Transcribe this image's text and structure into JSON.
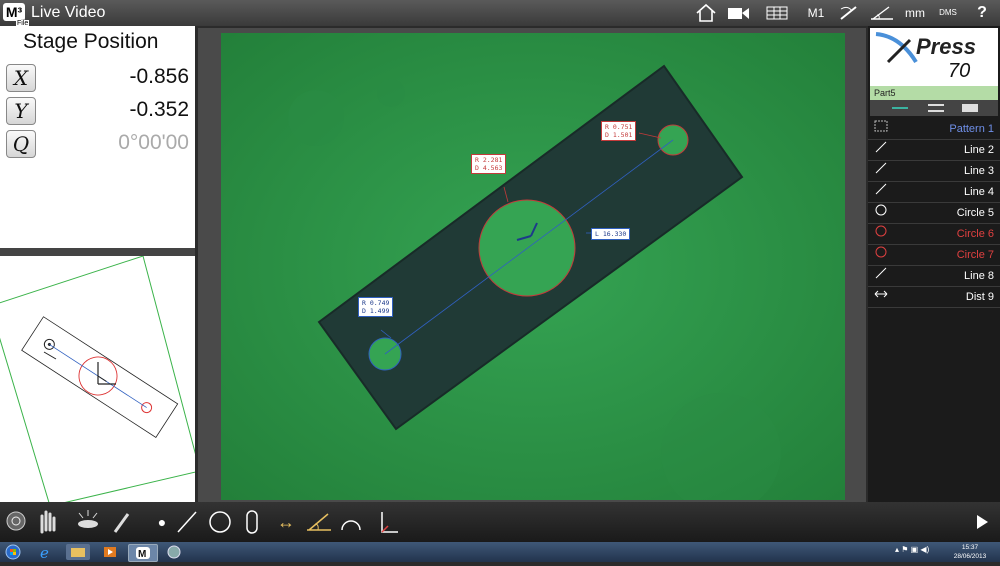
{
  "titlebar": {
    "logo": "M³",
    "file_label": "File",
    "title": "Live Video",
    "icons": [
      "home-icon",
      "video-camera-icon",
      "grid-icon",
      "machine-label",
      "probe-icon",
      "angle-icon",
      "units-label",
      "angle-format-label",
      "help-icon"
    ],
    "machine": "M1",
    "units": "mm",
    "angle_format": "DMS",
    "help": "?"
  },
  "stage": {
    "title": "Stage Position",
    "x_label": "X",
    "y_label": "Y",
    "q_label": "Q",
    "x_value": "-0.856",
    "y_value": "-0.352",
    "q_value": "0°00'00"
  },
  "video": {
    "tags": {
      "top_right": {
        "r": "R 0.751",
        "d": "D 1.501"
      },
      "center": {
        "r": "R 2.281",
        "d": "D 4.563"
      },
      "line": "L 16.330",
      "left": {
        "r": "R 0.749",
        "d": "D 1.499"
      }
    }
  },
  "logo_panel": {
    "brand": "Press",
    "model": "70",
    "part": "Part5"
  },
  "features": [
    {
      "label": "Pattern 1",
      "icon": "pattern-icon",
      "color": "#6f8fe8"
    },
    {
      "label": "Line 2",
      "icon": "line-icon",
      "color": "#ffffff"
    },
    {
      "label": "Line 3",
      "icon": "line-icon",
      "color": "#ffffff"
    },
    {
      "label": "Line 4",
      "icon": "line-icon",
      "color": "#ffffff"
    },
    {
      "label": "Circle 5",
      "icon": "circle-icon",
      "color": "#ffffff"
    },
    {
      "label": "Circle 6",
      "icon": "circle-icon",
      "color": "#e04040"
    },
    {
      "label": "Circle 7",
      "icon": "circle-icon",
      "color": "#e04040"
    },
    {
      "label": "Line 8",
      "icon": "line-icon",
      "color": "#ffffff"
    },
    {
      "label": "Dist 9",
      "icon": "distance-icon",
      "color": "#ffffff"
    }
  ],
  "toolbar": {
    "tools": [
      "zoom-tool-icon",
      "hand-tool-icon",
      "light-icon",
      "pen-icon",
      "point-icon",
      "line-tool-icon",
      "circle-tool-icon",
      "slot-tool-icon",
      "distance-tool-icon",
      "angle-tool-icon",
      "arc-tool-icon",
      "datum-tool-icon",
      "play-icon"
    ]
  },
  "taskbar": {
    "time": "15:37",
    "date": "28/06/2013"
  },
  "colors": {
    "video_green": "#2e9a4a",
    "part_dark": "#203a36",
    "accent_red": "#e04040",
    "accent_blue": "#3060c0"
  }
}
